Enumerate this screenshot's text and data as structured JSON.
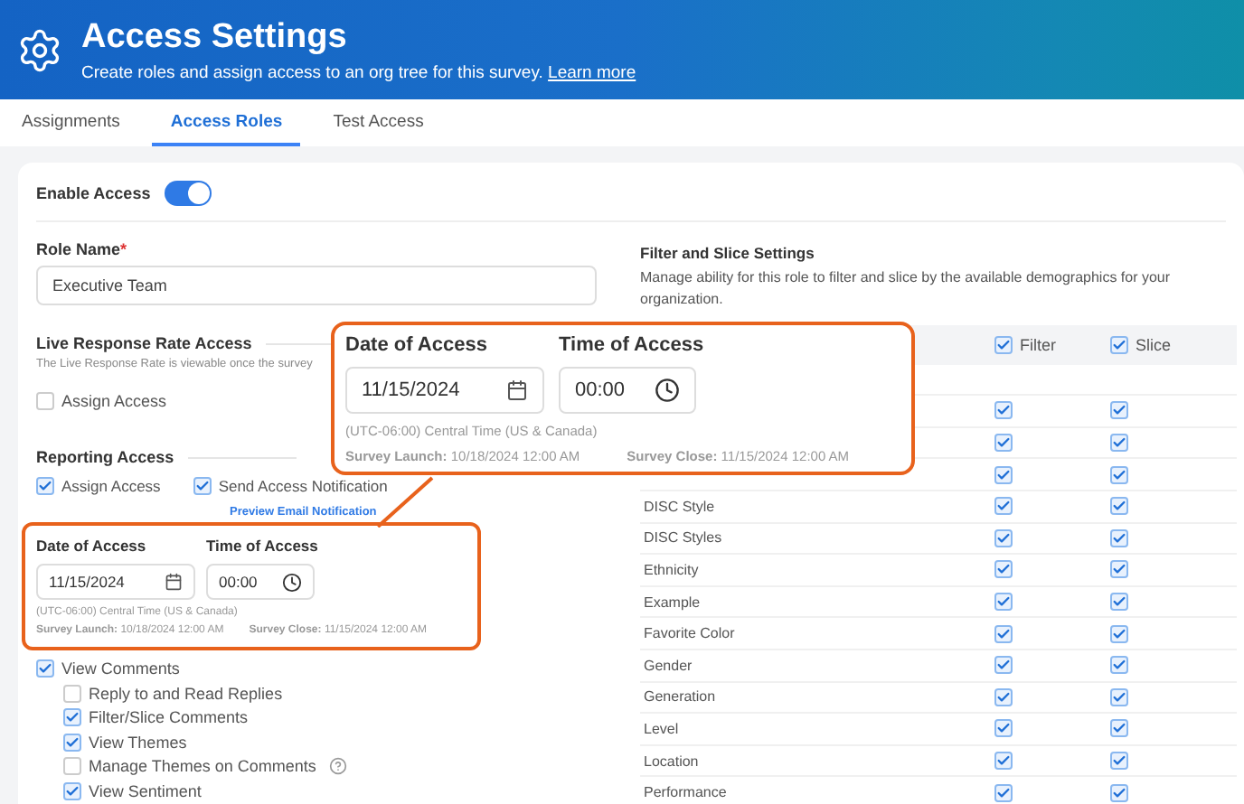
{
  "header": {
    "title": "Access Settings",
    "subtitle": "Create roles and assign access to an org tree for this survey.",
    "link": "Learn more"
  },
  "tabs": [
    {
      "label": "Assignments",
      "selected": false
    },
    {
      "label": "Access Roles",
      "selected": true
    },
    {
      "label": "Test Access",
      "selected": false
    }
  ],
  "enable_access": {
    "label": "Enable Access",
    "on": true
  },
  "role_name": {
    "label": "Role Name",
    "required": true,
    "required_mark": "*",
    "value": "Executive Team"
  },
  "live_response": {
    "title": "Live Response Rate Access",
    "description": "The Live Response Rate is viewable once the survey",
    "assign": {
      "label": "Assign Access",
      "checked": false
    }
  },
  "reporting_access": {
    "title": "Reporting Access",
    "options": [
      {
        "label": "Assign Access",
        "checked": true
      },
      {
        "label": "Send Access Notification",
        "checked": true
      }
    ],
    "preview_link": "Preview Email Notification"
  },
  "access_date": {
    "date_label": "Date of Access",
    "date": "11/15/2024",
    "time_label": "Time of Access",
    "time": "00:00",
    "timezone": "(UTC-06:00) Central Time (US & Canada)",
    "launch_label": "Survey Launch:",
    "launch": "10/18/2024 12:00 AM",
    "close_label": "Survey Close:",
    "close": "11/15/2024 12:00 AM"
  },
  "callout": {
    "date_label": "Date of Access",
    "date": "11/15/2024",
    "time_label": "Time of Access",
    "time": "00:00",
    "timezone": "(UTC-06:00) Central Time (US & Canada)",
    "launch_label": "Survey Launch:",
    "launch": "10/18/2024 12:00 AM",
    "close_label": "Survey Close:",
    "close": "11/15/2024 12:00 AM"
  },
  "comments": [
    {
      "label": "View Comments",
      "checked": true,
      "children": [
        {
          "label": "Reply to and Read Replies",
          "checked": false,
          "help": false
        },
        {
          "label": "Filter/Slice Comments",
          "checked": true,
          "help": false
        },
        {
          "label": "View Themes",
          "checked": true,
          "help": false
        },
        {
          "label": "Manage Themes on Comments",
          "checked": false,
          "help": true
        },
        {
          "label": "View Sentiment",
          "checked": true,
          "help": false
        }
      ]
    }
  ],
  "filter_slice": {
    "title": "Filter and Slice Settings",
    "description": "Manage ability for this role to filter and slice by the available demographics for your organization.",
    "columns": [
      {
        "label": "Filter",
        "checked": true
      },
      {
        "label": "Slice",
        "checked": true
      }
    ],
    "rows": [
      {
        "filter": true,
        "slice": true
      },
      {
        "filter": true,
        "slice": true
      },
      {
        "filter": true,
        "slice": true
      },
      {
        "name": "DISC Style",
        "filter": true,
        "slice": true
      },
      {
        "name": "DISC Styles",
        "filter": true,
        "slice": true
      },
      {
        "name": "Ethnicity",
        "filter": true,
        "slice": true
      },
      {
        "name": "Example",
        "filter": true,
        "slice": true
      },
      {
        "name": "Favorite Color",
        "filter": true,
        "slice": true
      },
      {
        "name": "Gender",
        "filter": true,
        "slice": true
      },
      {
        "name": "Generation",
        "filter": true,
        "slice": true
      },
      {
        "name": "Level",
        "filter": true,
        "slice": true
      },
      {
        "name": "Location",
        "filter": true,
        "slice": true
      },
      {
        "name": "Performance",
        "filter": true,
        "slice": true
      }
    ]
  }
}
